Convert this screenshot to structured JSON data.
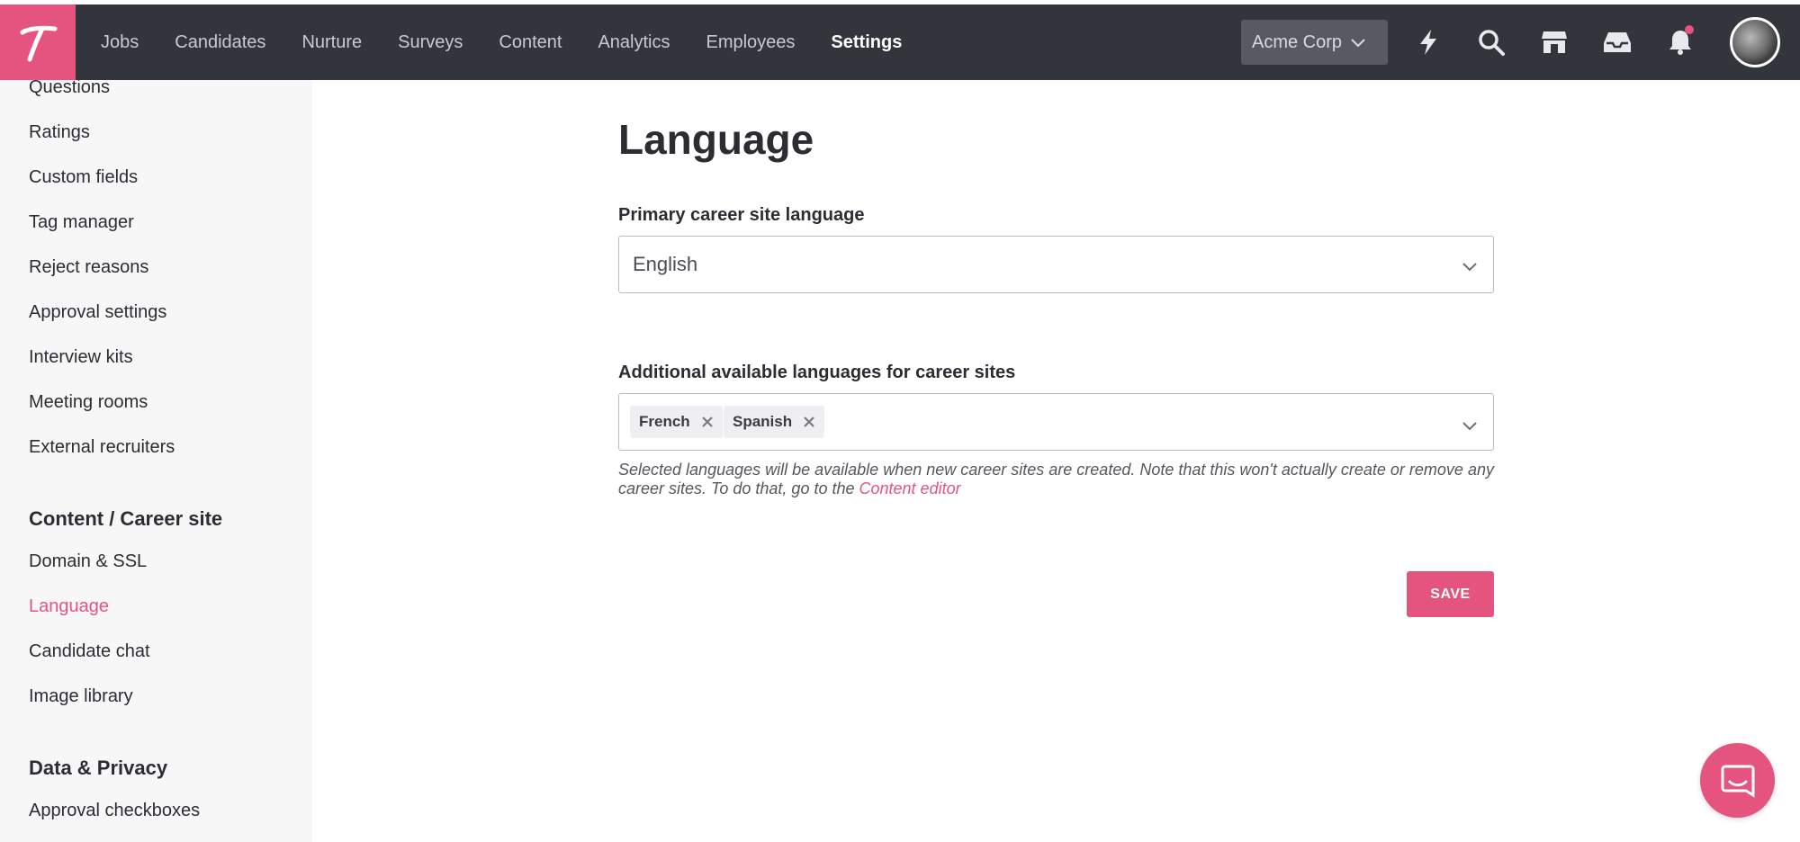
{
  "nav": {
    "items": [
      {
        "label": "Jobs"
      },
      {
        "label": "Candidates"
      },
      {
        "label": "Nurture"
      },
      {
        "label": "Surveys"
      },
      {
        "label": "Content"
      },
      {
        "label": "Analytics"
      },
      {
        "label": "Employees"
      },
      {
        "label": "Settings",
        "active": true
      }
    ],
    "company": "Acme Corp",
    "icons": [
      "lightning-icon",
      "search-icon",
      "store-icon",
      "inbox-icon",
      "bell-icon"
    ]
  },
  "sidebar": {
    "items_top": [
      "Questions",
      "Ratings",
      "Custom fields",
      "Tag manager",
      "Reject reasons",
      "Approval settings",
      "Interview kits",
      "Meeting rooms",
      "External recruiters"
    ],
    "section_career": "Content / Career site",
    "items_career": [
      "Domain & SSL",
      "Language",
      "Candidate chat",
      "Image library"
    ],
    "section_privacy": "Data & Privacy",
    "items_privacy": [
      "Approval checkboxes"
    ]
  },
  "main": {
    "title": "Language",
    "primary_label": "Primary career site language",
    "primary_value": "English",
    "additional_label": "Additional available languages for career sites",
    "additional_tags": [
      "French",
      "Spanish"
    ],
    "help_text": "Selected languages will be available when new career sites are created. Note that this won't actually create or remove any career sites. To do that, go to the",
    "help_link": "Content editor",
    "save_label": "SAVE"
  },
  "colors": {
    "accent": "#e4547f",
    "topbar": "#33353d",
    "sidebar_bg": "#f7f7f8"
  }
}
